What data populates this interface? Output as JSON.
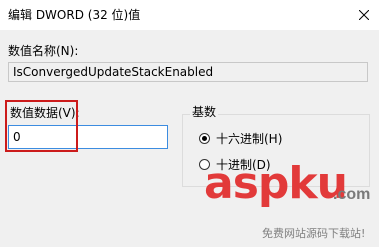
{
  "window": {
    "title": "编辑 DWORD (32 位)值"
  },
  "name_label": "数值名称(N):",
  "name_value": "IsConvergedUpdateStackEnabled",
  "data_label": "数值数据(V):",
  "data_value": "0",
  "base_group": {
    "title": "基数",
    "options": [
      {
        "label": "十六进制(H)",
        "checked": true
      },
      {
        "label": "十进制(D)",
        "checked": false
      }
    ]
  },
  "watermark": {
    "brand": "aspku",
    "suffix": ".com",
    "subtitle": "免费网站源码下载站!"
  },
  "colors": {
    "highlight": "#cc1b1b",
    "input_border": "#3c8ce0",
    "watermark": "#e23a3a"
  }
}
